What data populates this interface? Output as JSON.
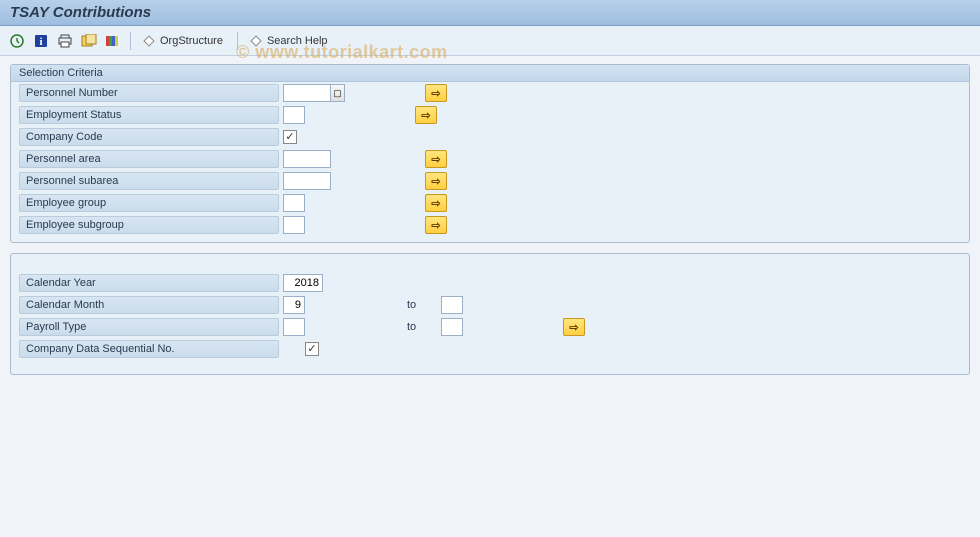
{
  "header": {
    "title": "TSAY Contributions"
  },
  "toolbar": {
    "org_structure": "OrgStructure",
    "search_help": "Search Help"
  },
  "group1": {
    "title": "Selection Criteria",
    "rows": {
      "personnel_number": {
        "label": "Personnel Number",
        "value": ""
      },
      "employment_status": {
        "label": "Employment Status",
        "value": ""
      },
      "company_code": {
        "label": "Company Code",
        "checked": "✓"
      },
      "personnel_area": {
        "label": "Personnel area",
        "value": ""
      },
      "personnel_subarea": {
        "label": "Personnel subarea",
        "value": ""
      },
      "employee_group": {
        "label": "Employee group",
        "value": ""
      },
      "employee_subgroup": {
        "label": "Employee subgroup",
        "value": ""
      }
    }
  },
  "group2": {
    "rows": {
      "calendar_year": {
        "label": "Calendar Year",
        "value": "2018"
      },
      "calendar_month": {
        "label": "Calendar Month",
        "value": "9",
        "to_label": "to",
        "to_value": ""
      },
      "payroll_type": {
        "label": "Payroll Type",
        "value": "",
        "to_label": "to",
        "to_value": ""
      },
      "company_data_seq": {
        "label": "Company Data Sequential No.",
        "checked": "✓"
      }
    }
  },
  "watermark": "© www.tutorialkart.com"
}
